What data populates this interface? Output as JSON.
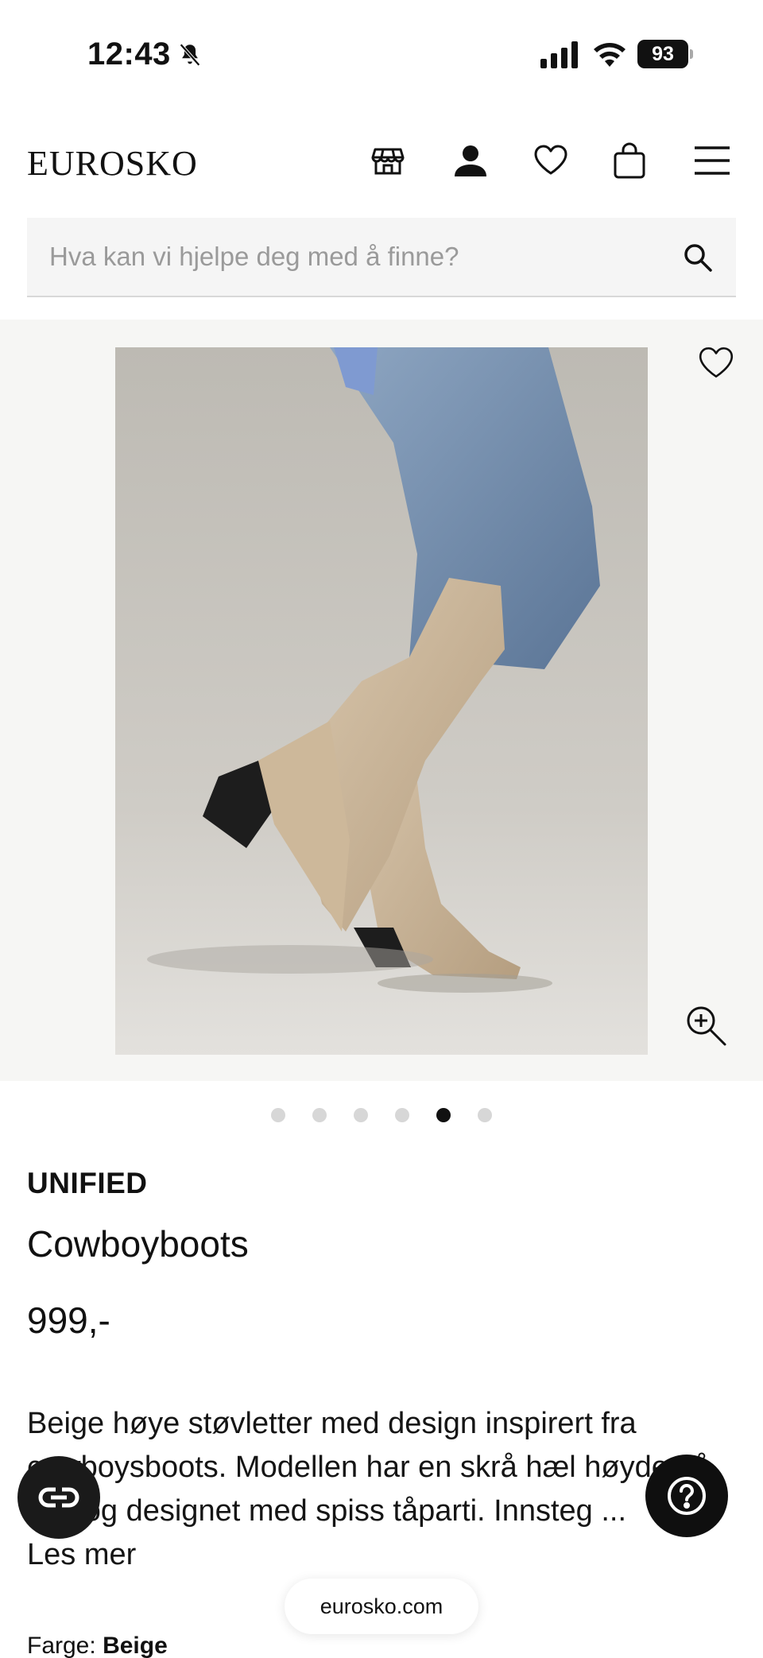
{
  "status_bar": {
    "time": "12:43",
    "battery": "93"
  },
  "header": {
    "logo": "EUROSKO",
    "icons": [
      "store-icon",
      "account-icon",
      "wishlist-heart-icon",
      "shopping-bag-icon",
      "menu-icon"
    ]
  },
  "search": {
    "placeholder": "Hva kan vi hjelpe deg med å finne?"
  },
  "gallery": {
    "image_count": 6,
    "active_index": 4
  },
  "product": {
    "brand": "UNIFIED",
    "name": "Cowboyboots",
    "price": "999,-",
    "description": "Beige høye støvletter med design inspirert fra cowboysboots. Modellen har en skrå hæl høyde på ? cm, og designet med spiss tåparti. Innsteg ...",
    "description_visible_line1": "Beige høye støvletter med design inspirert fra",
    "description_visible_line2": "cowboysboots. Modellen har en skrå hæl høyde på",
    "description_visible_line3": "cm, og designet med spiss tåparti. Innsteg ...",
    "read_more": "Les mer",
    "color_label": "Farge:",
    "color_value": "Beige"
  },
  "browser": {
    "url": "eurosko.com"
  },
  "colors": {
    "gallery_bg": "#f6f6f4",
    "search_bg": "#f5f5f5",
    "text": "#111111"
  }
}
